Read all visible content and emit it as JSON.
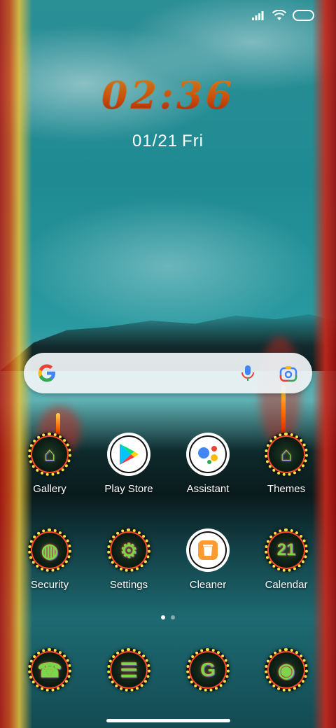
{
  "status_bar": {
    "signal_icon": "cellular-signal-icon",
    "wifi_icon": "wifi-icon",
    "battery_icon": "battery-icon"
  },
  "lock_clock": {
    "time": "02:36",
    "date": "01/21",
    "weekday": "Fri"
  },
  "search_widget": {
    "google_icon": "google-g-icon",
    "mic_icon": "microphone-icon",
    "lens_icon": "google-lens-icon"
  },
  "apps_row1": [
    {
      "label": "Gallery",
      "icon": "gallery-icon",
      "glyph": "⌂"
    },
    {
      "label": "Play Store",
      "icon": "play-store-icon",
      "glyph": "▶"
    },
    {
      "label": "Assistant",
      "icon": "assistant-icon",
      "glyph": "●"
    },
    {
      "label": "Themes",
      "icon": "themes-icon",
      "glyph": "⌂"
    }
  ],
  "apps_row2": [
    {
      "label": "Security",
      "icon": "security-icon",
      "glyph": "◍"
    },
    {
      "label": "Settings",
      "icon": "settings-icon",
      "glyph": "⚙"
    },
    {
      "label": "Cleaner",
      "icon": "cleaner-icon",
      "glyph": "🗑"
    },
    {
      "label": "Calendar",
      "icon": "calendar-icon",
      "glyph": "21"
    }
  ],
  "dock": [
    {
      "icon": "phone-icon",
      "glyph": "☎"
    },
    {
      "icon": "messages-icon",
      "glyph": "☰"
    },
    {
      "icon": "google-icon",
      "glyph": "G"
    },
    {
      "icon": "camera-icon",
      "glyph": "◉"
    }
  ],
  "page_indicator": {
    "pages": 2,
    "active": 1
  },
  "colors": {
    "clock_fire": "#ff7a10",
    "icon_border": "#ffe14a",
    "search_bg": "#f0f4f6"
  }
}
